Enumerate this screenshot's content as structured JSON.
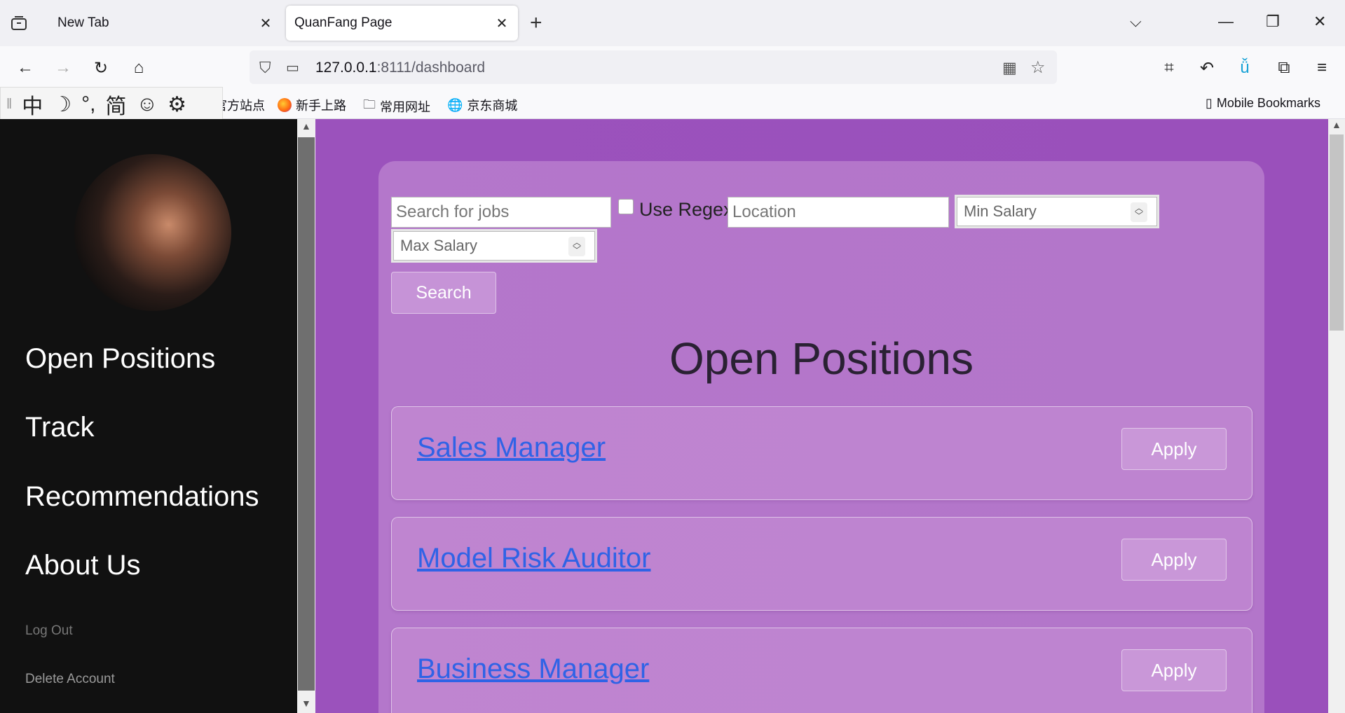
{
  "browser": {
    "tabs": [
      {
        "label": "New Tab",
        "active": false
      },
      {
        "label": "QuanFang Page",
        "active": true
      }
    ],
    "url_host": "127.0.0.1",
    "url_rest": ":8111/dashboard",
    "bookmarks": [
      "官方站点",
      "新手上路",
      "常用网址",
      "京东商城"
    ],
    "mobile_bookmarks": "Mobile Bookmarks",
    "ime_items": [
      "中",
      "☽",
      "°,",
      "简",
      "☺",
      "⚙"
    ]
  },
  "sidebar": {
    "links": [
      "Open Positions",
      "Track",
      "Recommendations",
      "About Us"
    ],
    "log_out": "Log Out",
    "delete_account": "Delete Account"
  },
  "search": {
    "jobs_placeholder": "Search for jobs",
    "use_regex_label": "Use Regex",
    "location_placeholder": "Location",
    "min_salary_placeholder": "Min Salary",
    "max_salary_placeholder": "Max Salary",
    "button_label": "Search"
  },
  "heading": "Open Positions",
  "jobs": [
    {
      "title": "Sales Manager",
      "apply": "Apply"
    },
    {
      "title": "Model Risk Auditor",
      "apply": "Apply"
    },
    {
      "title": "Business Manager",
      "apply": "Apply"
    }
  ],
  "colors": {
    "main_bg": "#9b52bc",
    "sidebar_bg": "#111111",
    "link": "#2f63e6"
  }
}
